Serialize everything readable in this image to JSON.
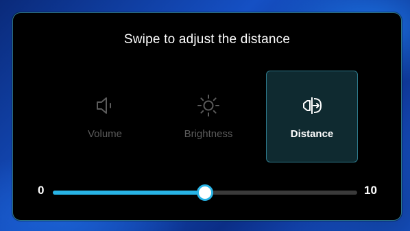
{
  "panel": {
    "title": "Swipe to adjust the distance"
  },
  "modes": [
    {
      "label": "Volume",
      "icon": "speaker-icon",
      "selected": false
    },
    {
      "label": "Brightness",
      "icon": "sun-icon",
      "selected": false
    },
    {
      "label": "Distance",
      "icon": "distance-icon",
      "selected": true
    }
  ],
  "slider": {
    "min_label": "0",
    "max_label": "10",
    "value": 5,
    "min": 0,
    "max": 10
  },
  "colors": {
    "accent": "#28b4e6",
    "selected_bg": "#0f2a30",
    "selected_border": "#2e7a8c",
    "inactive_text": "#5c5c5c",
    "track": "#3a3a3a"
  }
}
